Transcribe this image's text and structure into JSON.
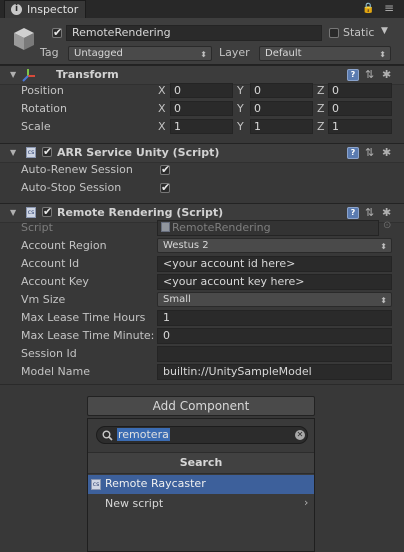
{
  "tab": {
    "title": "Inspector",
    "menu_glyphs": "🔒 ≡"
  },
  "header": {
    "name_value": "RemoteRendering",
    "static_label": "Static",
    "tag_label": "Tag",
    "tag_value": "Untagged",
    "layer_label": "Layer",
    "layer_value": "Default"
  },
  "transform": {
    "title": "Transform",
    "rows": [
      {
        "label": "Position",
        "x": "0",
        "y": "0",
        "z": "0"
      },
      {
        "label": "Rotation",
        "x": "0",
        "y": "0",
        "z": "0"
      },
      {
        "label": "Scale",
        "x": "1",
        "y": "1",
        "z": "1"
      }
    ],
    "axes": {
      "x": "X",
      "y": "Y",
      "z": "Z"
    }
  },
  "arr_service": {
    "title": "ARR Service Unity (Script)",
    "auto_renew_label": "Auto-Renew Session",
    "auto_stop_label": "Auto-Stop Session",
    "auto_renew": true,
    "auto_stop": true
  },
  "remote_rendering": {
    "title": "Remote Rendering (Script)",
    "script_label": "Script",
    "script_value": "RemoteRendering",
    "account_region_label": "Account Region",
    "account_region_value": "Westus 2",
    "account_id_label": "Account Id",
    "account_id_value": "<your account id here>",
    "account_key_label": "Account Key",
    "account_key_value": "<your account key here>",
    "vm_size_label": "Vm Size",
    "vm_size_value": "Small",
    "max_lease_hours_label": "Max Lease Time Hours",
    "max_lease_hours_value": "1",
    "max_lease_minutes_label": "Max Lease Time Minute:",
    "max_lease_minutes_value": "0",
    "session_id_label": "Session Id",
    "session_id_value": "",
    "model_name_label": "Model Name",
    "model_name_value": "builtin://UnitySampleModel"
  },
  "add_component": {
    "button_label": "Add Component",
    "search_value": "remotera",
    "section_title": "Search",
    "results": [
      "Remote Raycaster",
      "New script"
    ]
  },
  "icons": {
    "tab": "info-icon",
    "gameobject": "cube-icon",
    "transform": "transform-axes-icon",
    "script": "script-icon",
    "help": "help-icon",
    "presets": "presets-icon",
    "settings": "gear-icon"
  }
}
